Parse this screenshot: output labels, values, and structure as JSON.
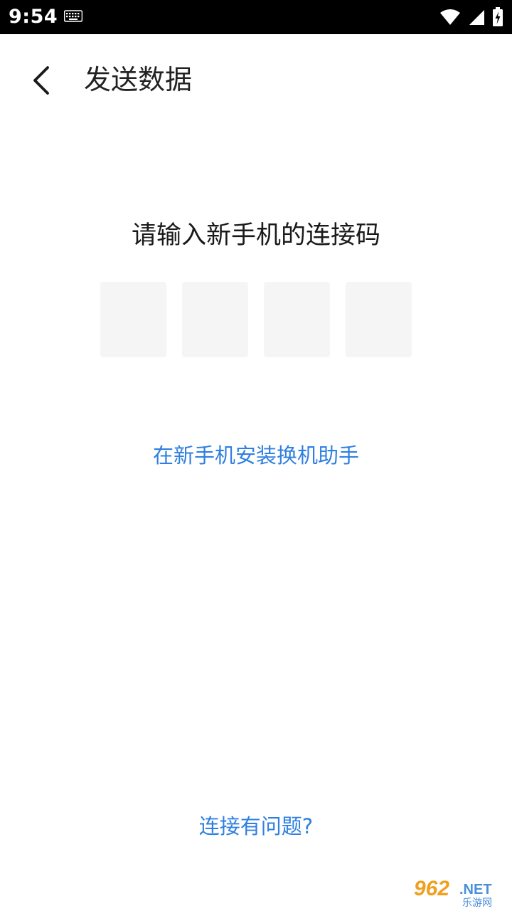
{
  "status_bar": {
    "time": "9:54",
    "icons": [
      "keyboard-icon",
      "wifi-icon",
      "cell-signal-icon",
      "battery-charging-icon"
    ]
  },
  "header": {
    "back_icon": "back-chevron-icon",
    "title": "发送数据"
  },
  "main": {
    "prompt": "请输入新手机的连接码",
    "code_digits": [
      "",
      "",
      "",
      ""
    ],
    "install_link": "在新手机安装换机助手",
    "problem_link": "连接有问题?"
  },
  "watermark": {
    "brand": "962",
    "suffix": ".NET",
    "caption": "乐游网"
  },
  "colors": {
    "status_bar_bg": "#000000",
    "link": "#2f7fe0",
    "code_box_bg": "#f5f5f5",
    "title_text": "#222222"
  }
}
